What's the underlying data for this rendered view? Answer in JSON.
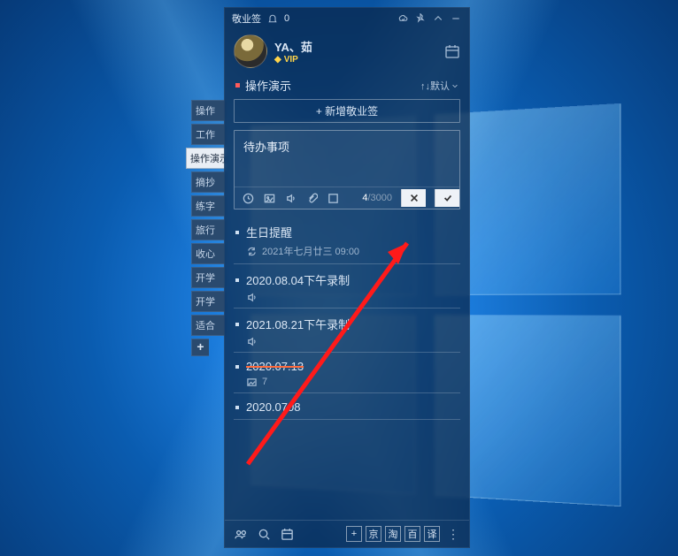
{
  "titlebar": {
    "app_name": "敬业签",
    "notif_count": "0"
  },
  "profile": {
    "username": "YA、茹",
    "vip_label": "VIP"
  },
  "side_tabs": {
    "items": [
      {
        "label": "操作"
      },
      {
        "label": "工作"
      },
      {
        "label": "操作演示",
        "active": true
      },
      {
        "label": "摘抄"
      },
      {
        "label": "练字"
      },
      {
        "label": "旅行"
      },
      {
        "label": "收心"
      },
      {
        "label": "开学"
      },
      {
        "label": "开学"
      },
      {
        "label": "适合"
      }
    ],
    "add": "+"
  },
  "section": {
    "title": "操作演示",
    "sort_label": "↑↓默认"
  },
  "add_button": "+ 新增敬业签",
  "editor": {
    "value": "待办事项",
    "count_current": "4",
    "count_max": "/3000"
  },
  "notes": [
    {
      "title": "生日提醒",
      "reminder": "2021年七月廿三  09:00",
      "has_repeat": true
    },
    {
      "title": "2020.08.04下午录制",
      "has_audio": true
    },
    {
      "title": "2021.08.21下午录制",
      "has_audio": true
    },
    {
      "title": "2020.07.13",
      "strike": true,
      "image_count": "7"
    },
    {
      "title": "2020.0708"
    }
  ],
  "bottom": {
    "shortcuts": [
      "京",
      "淘",
      "百",
      "译"
    ]
  }
}
